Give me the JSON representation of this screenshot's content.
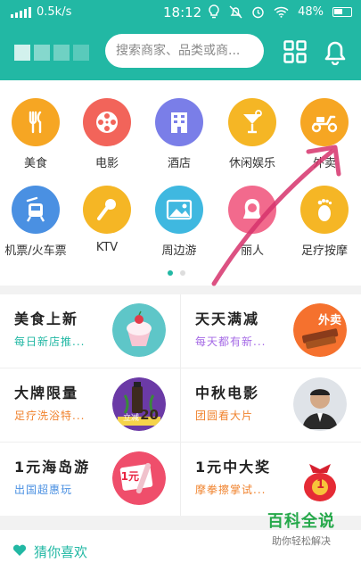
{
  "status_bar": {
    "network_speed": "0.5k/s",
    "time": "18:12",
    "battery": "48%"
  },
  "header": {
    "search_placeholder": "搜索商家、品类或商..."
  },
  "categories": [
    {
      "label": "美食",
      "icon": "fork-knife-icon",
      "color": "#f6a623"
    },
    {
      "label": "电影",
      "icon": "film-reel-icon",
      "color": "#f2645a"
    },
    {
      "label": "酒店",
      "icon": "hotel-building-icon",
      "color": "#7a7ee8"
    },
    {
      "label": "休闲娱乐",
      "icon": "cocktail-icon",
      "color": "#f5b625"
    },
    {
      "label": "外卖",
      "icon": "scooter-icon",
      "color": "#f6a623"
    },
    {
      "label": "机票/火车票",
      "icon": "train-icon",
      "color": "#4a90e2"
    },
    {
      "label": "KTV",
      "icon": "microphone-icon",
      "color": "#f5b625"
    },
    {
      "label": "周边游",
      "icon": "landscape-icon",
      "color": "#3fb8e0"
    },
    {
      "label": "丽人",
      "icon": "woman-icon",
      "color": "#f26a8d"
    },
    {
      "label": "足疗按摩",
      "icon": "footprint-icon",
      "color": "#f5b625"
    }
  ],
  "promos": [
    {
      "title": "美食上新",
      "subtitle": "每日新店推...",
      "subtitle_color": "#22b8a4"
    },
    {
      "title": "天天满减",
      "subtitle": "每天都有新...",
      "subtitle_color": "#a56ae6"
    },
    {
      "title": "大牌限量",
      "subtitle": "足疗洗浴特...",
      "subtitle_color": "#f0832e"
    },
    {
      "title": "中秋电影",
      "subtitle": "团圆看大片",
      "subtitle_color": "#f0832e"
    },
    {
      "title": "1元海岛游",
      "subtitle": "出国超惠玩",
      "subtitle_color": "#4a90e2"
    },
    {
      "title": "1元中大奖",
      "subtitle": "摩拳擦掌试...",
      "subtitle_color": "#f0832e"
    }
  ],
  "promo_badges": {
    "waimai": "外卖",
    "one_yuan": "1元",
    "ticket_price": "20",
    "ticket_stamp": "立减",
    "lucky_bag_number": "1"
  },
  "guess_section": {
    "title": "猜你喜欢"
  },
  "watermark": {
    "title": "百科全说",
    "subtitle": "助你轻松解决"
  },
  "colors": {
    "brand": "#22b8a4",
    "annotation_arrow": "#d6336c"
  }
}
